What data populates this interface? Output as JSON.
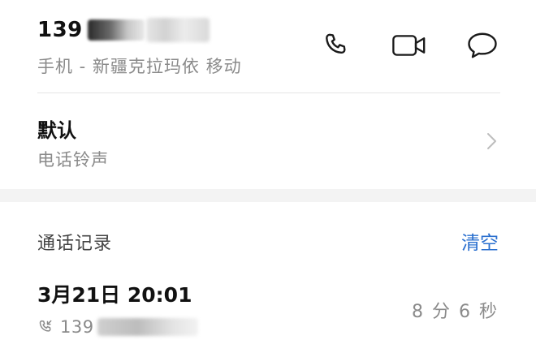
{
  "contact": {
    "number_prefix": "139",
    "number_detail": "手机 - 新疆克拉玛依 移动"
  },
  "actions": {
    "call_icon": "phone-icon",
    "video_icon": "video-camera-icon",
    "message_icon": "message-bubble-icon"
  },
  "ringtone": {
    "title": "默认",
    "subtitle": "电话铃声"
  },
  "call_records": {
    "title": "通话记录",
    "clear_label": "清空",
    "items": [
      {
        "datetime": "3月21日 20:01",
        "number_prefix": "139",
        "duration": "8 分 6 秒"
      }
    ]
  },
  "colors": {
    "accent": "#2a6fcf",
    "secondary_text": "#8a8a8a",
    "primary_text": "#111111"
  }
}
